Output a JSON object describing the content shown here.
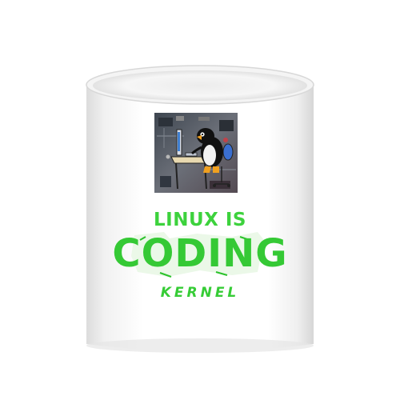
{
  "product": {
    "type": "mug",
    "body_color": "#ffffff",
    "print_green": "#3dd23d",
    "print_green_dark": "#1f9a22"
  },
  "print": {
    "line1": "LINUX IS",
    "line2": "CODING",
    "line3": "KERNEL"
  },
  "artwork": {
    "subject": "penguin-at-computer-desk-icon",
    "background": "circuit-board"
  }
}
